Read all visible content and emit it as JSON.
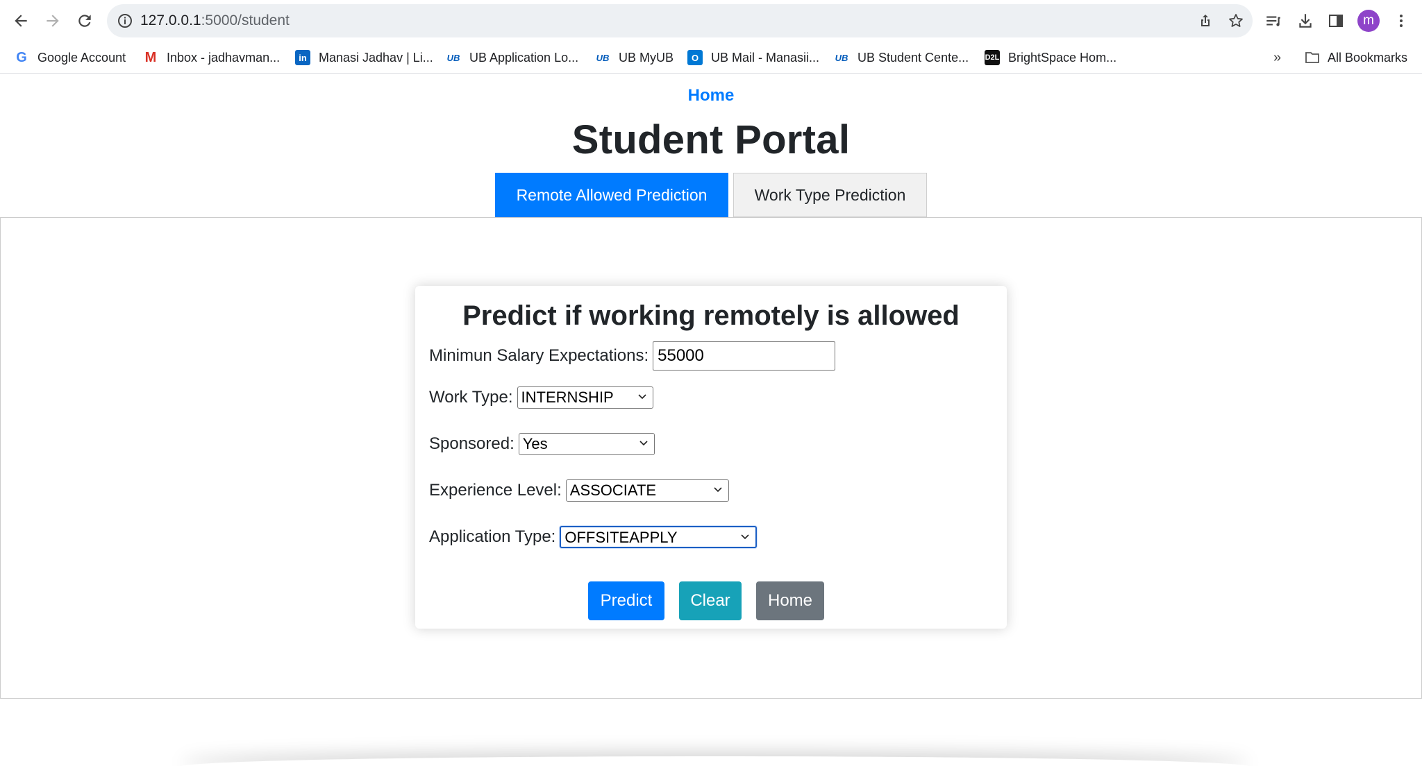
{
  "browser": {
    "url_host": "127.0.0.1",
    "url_path": ":5000/student",
    "profile_initial": "m",
    "bookmarks": [
      {
        "label": "Google Account",
        "icon": "google-icon"
      },
      {
        "label": "Inbox - jadhavman...",
        "icon": "gmail-icon"
      },
      {
        "label": "Manasi Jadhav | Li...",
        "icon": "linkedin-icon"
      },
      {
        "label": "UB Application Lo...",
        "icon": "ub-icon"
      },
      {
        "label": "UB MyUB",
        "icon": "ub-icon"
      },
      {
        "label": "UB Mail - Manasii...",
        "icon": "outlook-icon"
      },
      {
        "label": "UB Student Cente...",
        "icon": "ub-icon"
      },
      {
        "label": "BrightSpace Hom...",
        "icon": "d2l-icon"
      }
    ],
    "more_bookmarks": "»",
    "all_bookmarks": "All Bookmarks"
  },
  "page": {
    "home_link": "Home",
    "title": "Student Portal",
    "tabs": [
      {
        "label": "Remote Allowed Prediction",
        "active": true
      },
      {
        "label": "Work Type Prediction",
        "active": false
      }
    ]
  },
  "form": {
    "title": "Predict if working remotely is allowed",
    "salary": {
      "label": "Minimun Salary Expectations:",
      "value": "55000"
    },
    "work_type": {
      "label": "Work Type:",
      "value": "INTERNSHIP"
    },
    "sponsored": {
      "label": "Sponsored:",
      "value": "Yes"
    },
    "experience": {
      "label": "Experience Level:",
      "value": "ASSOCIATE"
    },
    "application": {
      "label": "Application Type:",
      "value": "OFFSITEAPPLY"
    },
    "buttons": {
      "predict": "Predict",
      "clear": "Clear",
      "home": "Home"
    }
  },
  "colors": {
    "primary": "#007bff",
    "info": "#17a2b8",
    "secondary": "#6c757d"
  }
}
